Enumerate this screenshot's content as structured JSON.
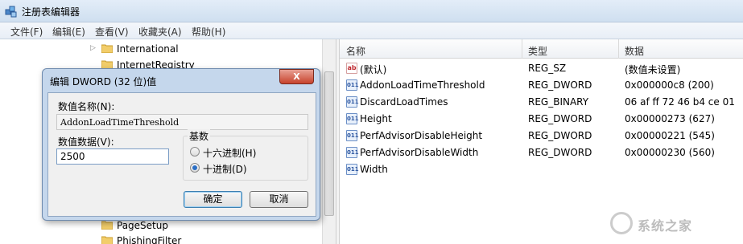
{
  "window": {
    "title": "注册表编辑器",
    "icon": "regedit-icon"
  },
  "menu": [
    "文件(F)",
    "编辑(E)",
    "查看(V)",
    "收藏夹(A)",
    "帮助(H)"
  ],
  "tree": {
    "items": [
      "International",
      "InternetRegistry",
      "PageSetup",
      "PhishingFilter"
    ]
  },
  "list": {
    "columns": {
      "name": "名称",
      "type": "类型",
      "data": "数据"
    },
    "rows": [
      {
        "icon": "ab",
        "name": "(默认)",
        "type": "REG_SZ",
        "data": "(数值未设置)"
      },
      {
        "icon": "bin",
        "name": "AddonLoadTimeThreshold",
        "type": "REG_DWORD",
        "data": "0x000000c8 (200)"
      },
      {
        "icon": "bin",
        "name": "DiscardLoadTimes",
        "type": "REG_BINARY",
        "data": "06 af ff 72 46 b4 ce 01"
      },
      {
        "icon": "bin",
        "name": "Height",
        "type": "REG_DWORD",
        "data": "0x00000273 (627)"
      },
      {
        "icon": "bin",
        "name": "PerfAdvisorDisableHeight",
        "type": "REG_DWORD",
        "data": "0x00000221 (545)"
      },
      {
        "icon": "bin",
        "name": "PerfAdvisorDisableWidth",
        "type": "REG_DWORD",
        "data": "0x00000230 (560)"
      },
      {
        "icon": "bin",
        "name": "Width",
        "type": "",
        "data": ""
      }
    ]
  },
  "dialog": {
    "title": "编辑 DWORD (32 位)值",
    "close_label": "X",
    "name_label": "数值名称(N):",
    "name_value": "AddonLoadTimeThreshold",
    "data_label": "数值数据(V):",
    "data_value": "2500",
    "base_label": "基数",
    "hex_label": "十六进制(H)",
    "dec_label": "十进制(D)",
    "selected_base": "decimal",
    "ok_label": "确定",
    "cancel_label": "取消"
  },
  "watermark": {
    "text": "系统之家"
  }
}
